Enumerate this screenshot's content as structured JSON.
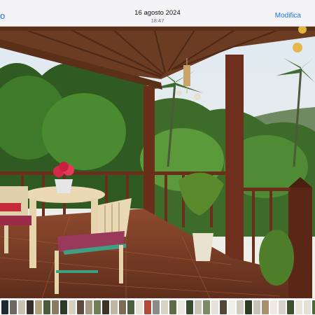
{
  "header": {
    "back_label": "o",
    "date": "16 agosto 2024",
    "time": "18:47",
    "edit_label": "Modifica"
  },
  "filmstrip": {
    "thumbnail_colors": [
      "#1d2a33",
      "#6e6a60",
      "#c7c2b4",
      "#34302a",
      "#b0a37f",
      "#4a5b3c",
      "#8a7b63",
      "#2f3a2b",
      "#d6d0c1",
      "#5d4a3a",
      "#a49a83",
      "#6f7f5a",
      "#3c3328",
      "#c1b8a3",
      "#7d6b55",
      "#4d5d3f",
      "#e8e3d8",
      "#b24a3a",
      "#8a8a86",
      "#d9d3c4",
      "#5c6b4a",
      "#ece8df",
      "#3a4a2e",
      "#c9c4b6",
      "#7c8a6a",
      "#e6e2d8",
      "#50473b",
      "#f1eee8",
      "#d0ccc2",
      "#2c3b22",
      "#c8c3b8",
      "#a88f6e",
      "#eeeae2",
      "#d7d3ca",
      "#3d4f2f",
      "#e9e5dc",
      "#e4e0d6",
      "#4c6b34"
    ]
  }
}
